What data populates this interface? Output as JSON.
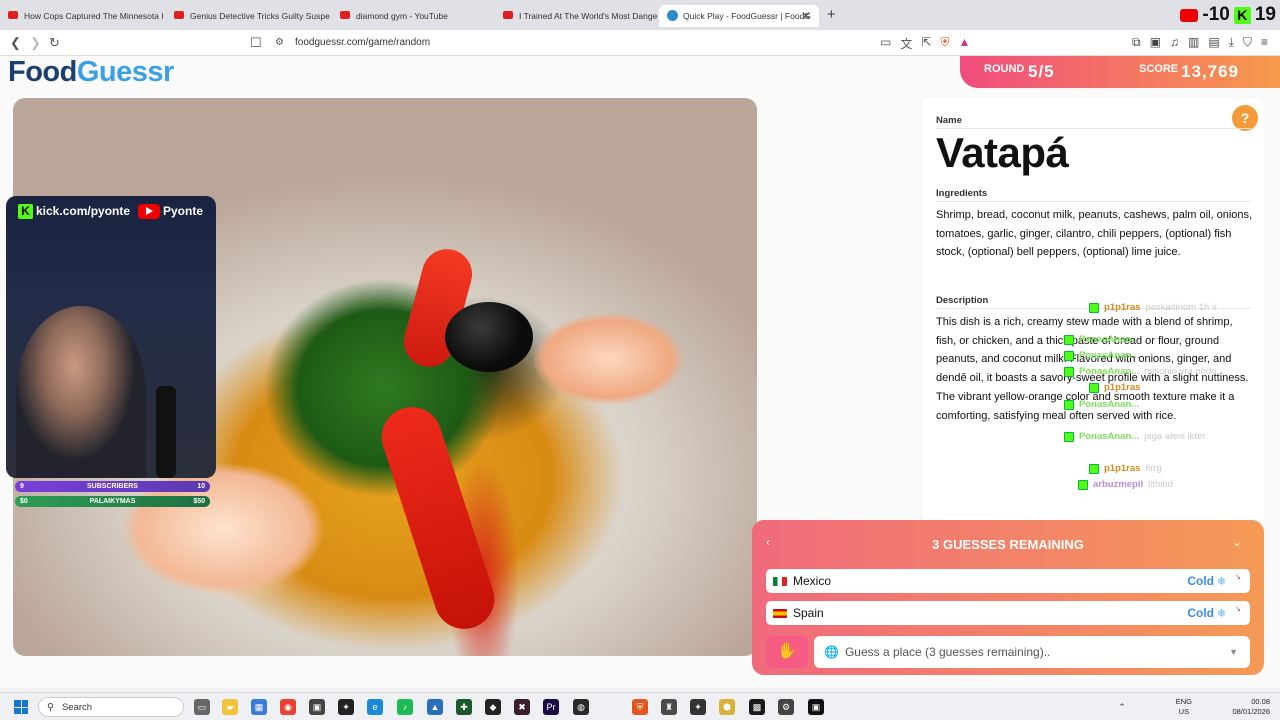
{
  "browser": {
    "tabs": [
      {
        "label": "How Cops Captured The Minnesota I"
      },
      {
        "label": "Genius Detective Tricks Guilty Suspe"
      },
      {
        "label": "diamond gym - YouTube"
      },
      {
        "label": "I Trained At The World's Most Dange"
      },
      {
        "label": "Quick Play - FoodGuessr | FoodG"
      }
    ],
    "url": "foodguessr.com/game/random",
    "counter_yt": "-10",
    "counter_k": "19"
  },
  "game": {
    "logo_food": "Food",
    "logo_guessr": "Guessr",
    "round_label": "ROUND",
    "round_value": "5/5",
    "score_label": "SCORE",
    "score_value": "13,769"
  },
  "overlay": {
    "kick_handle": "kick.com/pyonte",
    "yt_handle": "Pyonte",
    "subs_label": "SUBSCRIBERS",
    "subs_current": "9",
    "subs_goal": "10",
    "donor_name": "PALAIKYMAS",
    "donor_left": "$0",
    "donor_right": "$50"
  },
  "dish": {
    "name_label": "Name",
    "name": "Vatapá",
    "ingredients_label": "Ingredients",
    "ingredients": "Shrimp, bread, coconut milk, peanuts, cashews, palm oil, onions, tomatoes, garlic, ginger, cilantro, chili peppers, (optional) fish stock, (optional) bell peppers, (optional) lime juice.",
    "description_label": "Description",
    "description": "This dish is a rich, creamy stew made with a blend of shrimp, fish, or chicken, and a thick paste of bread or flour, ground peanuts, and coconut milk. Flavored with onions, ginger, and dendê oil, it boasts a savory-sweet profile with a slight nuttiness. The vibrant yellow-orange color and smooth texture make it a comforting, satisfying meal often served with rice."
  },
  "chat": [
    {
      "user": "p1p1ras",
      "msg": "paskaitinom 1h ir",
      "color": "#d98a1c"
    },
    {
      "user": "PonasAnan...",
      "msg": "",
      "color": "#7ee05a"
    },
    {
      "user": "PonasAnan...",
      "msg": "",
      "color": "#7ee05a"
    },
    {
      "user": "PonasAnan...",
      "msg": "misonio yra obdo",
      "color": "#7ee05a"
    },
    {
      "user": "p1p1ras",
      "msg": "",
      "color": "#d98a1c"
    },
    {
      "user": "PonasAnan...",
      "msg": "",
      "color": "#7ee05a"
    },
    {
      "user": "PonasAnan...",
      "msg": "jaga ateis ikter",
      "color": "#7ee05a"
    },
    {
      "user": "p1p1ras",
      "msg": "firrg",
      "color": "#d98a1c"
    },
    {
      "user": "arbuzmepil",
      "msg": "lithind",
      "color": "#b58fd6"
    }
  ],
  "guesses": {
    "title": "3 GUESSES REMAINING",
    "rows": [
      {
        "country": "Mexico",
        "temp": "Cold"
      },
      {
        "country": "Spain",
        "temp": "Cold"
      }
    ],
    "placeholder": "Guess a place (3 guesses remaining).."
  },
  "taskbar": {
    "search": "Search",
    "lang": "ENG",
    "region": "US",
    "time": "00.08",
    "date": "08/01/2026"
  }
}
